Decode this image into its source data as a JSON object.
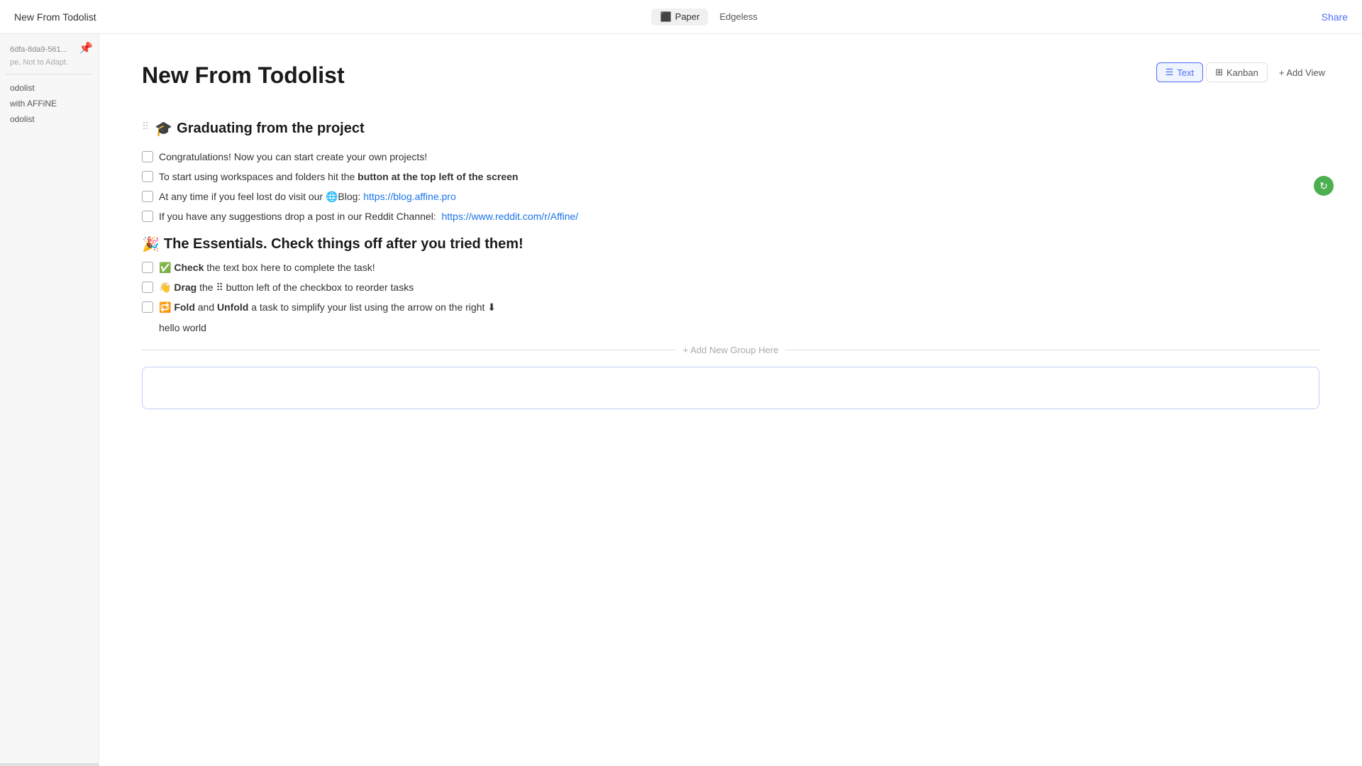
{
  "topbar": {
    "title": "New From Todolist",
    "tab_paper": "Paper",
    "tab_edgeless": "Edgeless",
    "share_label": "Share"
  },
  "sidebar": {
    "pin_icon": "📌",
    "item_id": "6dfa-8da9-561...",
    "item_sub": "pe, Not to Adapt.",
    "nav_items": [
      "odolist",
      "",
      "with AFFiNE",
      "odolist"
    ]
  },
  "page": {
    "title": "New From Todolist",
    "view_text": "Text",
    "view_kanban": "Kanban",
    "view_add": "+ Add View"
  },
  "sections": [
    {
      "emoji": "🎓",
      "heading": "Graduating from the project",
      "items": [
        {
          "checked": false,
          "text": "Congratulations! Now you can start create your own projects!"
        },
        {
          "checked": false,
          "text_parts": [
            "To start using workspaces and folders hit the ",
            {
              "bold": "button at the top left of the screen"
            }
          ]
        },
        {
          "checked": false,
          "text_parts": [
            "At any time if you feel lost do visit our 🌐Blog: ",
            {
              "link": "https://blog.affine.pro",
              "href": "https://blog.affine.pro"
            }
          ]
        },
        {
          "checked": false,
          "text_parts": [
            "If you have any suggestions drop a post in our Reddit Channel:  ",
            {
              "link": "https://www.reddit.com/r/Affine/",
              "href": "https://www.reddit.com/r/Affine/"
            }
          ]
        }
      ]
    },
    {
      "emoji": "🎉",
      "heading": " The Essentials. Check things off after you tried them!",
      "items": [
        {
          "checked": false,
          "text_parts": [
            "✅ ",
            {
              "bold": "Check"
            },
            " the text box here to complete the task!"
          ]
        },
        {
          "checked": false,
          "text_parts": [
            "👋 ",
            {
              "bold": "Drag"
            },
            " the ⠿ button left of the checkbox to reorder tasks"
          ]
        },
        {
          "checked": false,
          "text_parts": [
            "🔁 ",
            {
              "bold": "Fold"
            },
            " and ",
            {
              "bold": "Unfold"
            },
            " a task to simplify your list using the arrow on the right ⬇"
          ]
        }
      ]
    }
  ],
  "plain_text": "hello world",
  "add_group_label": "+ Add New Group Here"
}
